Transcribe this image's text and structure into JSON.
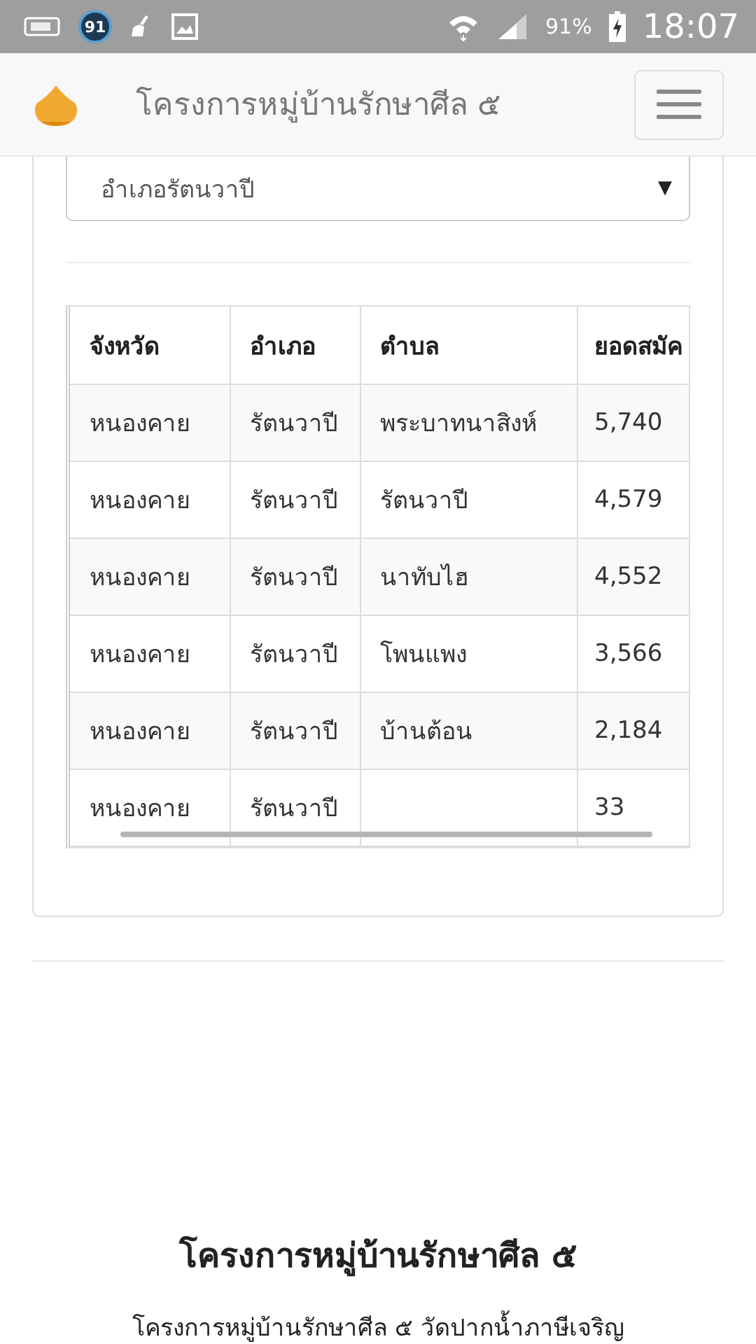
{
  "status_bar": {
    "badge": "91",
    "battery": "91%",
    "time": "18:07"
  },
  "navbar": {
    "title": "โครงการหมู่บ้านรักษาศีล ๕"
  },
  "filter": {
    "value": "อำเภอรัตนวาปี",
    "caret": "▼"
  },
  "table": {
    "columns": [
      "จังหวัด",
      "อำเภอ",
      "ตำบล",
      "ยอดสมัค"
    ],
    "rows": [
      {
        "cells": [
          "หนองคาย",
          "รัตนวาปี",
          "พระบาทนาสิงห์",
          "5,740"
        ]
      },
      {
        "cells": [
          "หนองคาย",
          "รัตนวาปี",
          "รัตนวาปี",
          "4,579"
        ]
      },
      {
        "cells": [
          "หนองคาย",
          "รัตนวาปี",
          "นาทับไฮ",
          "4,552"
        ]
      },
      {
        "cells": [
          "หนองคาย",
          "รัตนวาปี",
          "โพนแพง",
          "3,566"
        ]
      },
      {
        "cells": [
          "หนองคาย",
          "รัตนวาปี",
          "บ้านต้อน",
          "2,184"
        ]
      },
      {
        "cells": [
          "หนองคาย",
          "รัตนวาปี",
          "",
          "33"
        ]
      }
    ]
  },
  "footer": {
    "heading": "โครงการหมู่บ้านรักษาศีล ๕",
    "text": "โครงการหมู่บ้านรักษาศีล ๕ วัดปากน้ำภาษีเจริญ"
  }
}
